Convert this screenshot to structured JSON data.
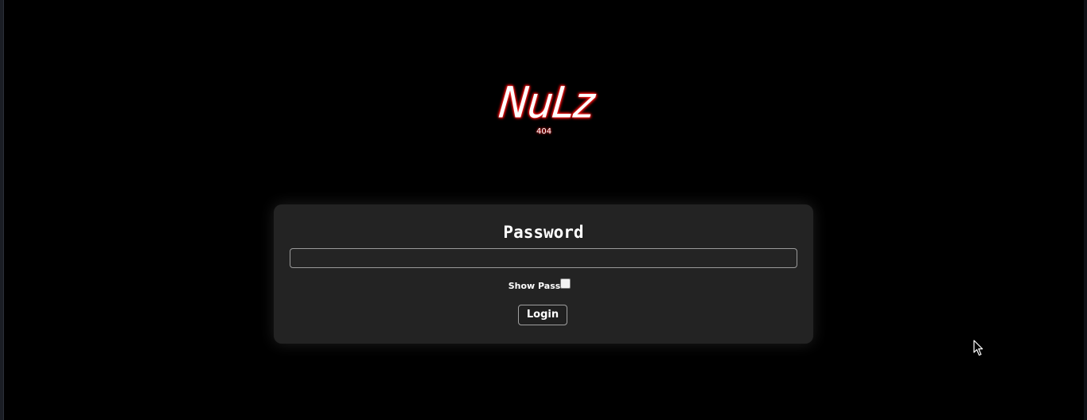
{
  "logo": {
    "title": "NuLz",
    "subtitle": "404"
  },
  "login": {
    "title": "Password",
    "password_value": "",
    "show_pass_label": "Show Pass",
    "show_pass_checked": false,
    "login_label": "Login"
  },
  "colors": {
    "background": "#000000",
    "card": "#232323",
    "logo_glow": "#c00000",
    "text": "#ffffff"
  },
  "icons": {
    "cursor": "mouse-pointer-icon"
  }
}
